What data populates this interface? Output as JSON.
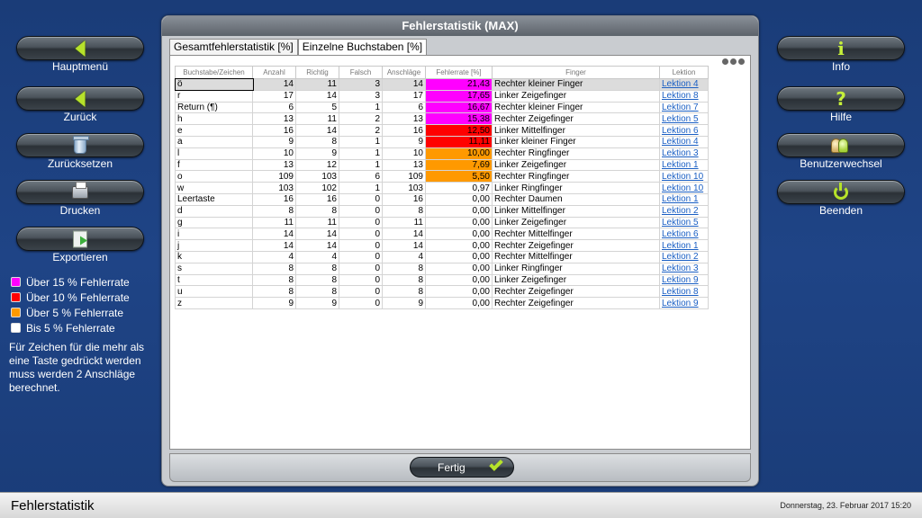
{
  "left_menu": [
    {
      "label": "Hauptmenü",
      "icon": "arrow-left-icon"
    },
    {
      "label": "Zurück",
      "icon": "arrow-left-icon"
    },
    {
      "label": "Zurücksetzen",
      "icon": "trash-icon"
    },
    {
      "label": "Drucken",
      "icon": "printer-icon"
    },
    {
      "label": "Exportieren",
      "icon": "export-icon"
    }
  ],
  "right_menu": [
    {
      "label": "Info",
      "icon": "info-icon"
    },
    {
      "label": "Hilfe",
      "icon": "help-icon"
    },
    {
      "label": "Benutzerwechsel",
      "icon": "users-icon"
    },
    {
      "label": "Beenden",
      "icon": "power-icon"
    }
  ],
  "legend": [
    {
      "label": "Über 15 % Fehlerrate",
      "color": "#ff00ff"
    },
    {
      "label": "Über 10 % Fehlerrate",
      "color": "#ff0000"
    },
    {
      "label": "Über 5 % Fehlerrate",
      "color": "#ff9900"
    },
    {
      "label": "Bis 5 % Fehlerrate",
      "color": "#ffffff"
    }
  ],
  "note": "Für Zeichen für die mehr als eine Taste gedrückt werden muss werden 2 Anschläge berechnet.",
  "window": {
    "title": "Fehlerstatistik (MAX)",
    "tabs": [
      "Gesamtfehlerstatistik [%]",
      "Einzelne Buchstaben [%]"
    ],
    "active_tab": 1,
    "ok_label": "Fertig"
  },
  "table": {
    "headers": [
      "Buchstabe/Zeichen",
      "Anzahl",
      "Richtig",
      "Falsch",
      "Anschläge",
      "Fehlerrate [%]",
      "Finger",
      "Lektion"
    ],
    "rows": [
      [
        "ö",
        "14",
        "11",
        "3",
        "14",
        "21,43",
        "Rechter kleiner Finger",
        "Lektion 4"
      ],
      [
        "r",
        "17",
        "14",
        "3",
        "17",
        "17,65",
        "Linker Zeigefinger",
        "Lektion 8"
      ],
      [
        "Return (¶)",
        "6",
        "5",
        "1",
        "6",
        "16,67",
        "Rechter kleiner Finger",
        "Lektion 7"
      ],
      [
        "h",
        "13",
        "11",
        "2",
        "13",
        "15,38",
        "Rechter Zeigefinger",
        "Lektion 5"
      ],
      [
        "e",
        "16",
        "14",
        "2",
        "16",
        "12,50",
        "Linker Mittelfinger",
        "Lektion 6"
      ],
      [
        "a",
        "9",
        "8",
        "1",
        "9",
        "11,11",
        "Linker kleiner Finger",
        "Lektion 4"
      ],
      [
        "l",
        "10",
        "9",
        "1",
        "10",
        "10,00",
        "Rechter Ringfinger",
        "Lektion 3"
      ],
      [
        "f",
        "13",
        "12",
        "1",
        "13",
        "7,69",
        "Linker Zeigefinger",
        "Lektion 1"
      ],
      [
        "o",
        "109",
        "103",
        "6",
        "109",
        "5,50",
        "Rechter Ringfinger",
        "Lektion 10"
      ],
      [
        "w",
        "103",
        "102",
        "1",
        "103",
        "0,97",
        "Linker Ringfinger",
        "Lektion 10"
      ],
      [
        "Leertaste",
        "16",
        "16",
        "0",
        "16",
        "0,00",
        "Rechter Daumen",
        "Lektion 1"
      ],
      [
        "d",
        "8",
        "8",
        "0",
        "8",
        "0,00",
        "Linker Mittelfinger",
        "Lektion 2"
      ],
      [
        "g",
        "11",
        "11",
        "0",
        "11",
        "0,00",
        "Linker Zeigefinger",
        "Lektion 5"
      ],
      [
        "i",
        "14",
        "14",
        "0",
        "14",
        "0,00",
        "Rechter Mittelfinger",
        "Lektion 6"
      ],
      [
        "j",
        "14",
        "14",
        "0",
        "14",
        "0,00",
        "Rechter Zeigefinger",
        "Lektion 1"
      ],
      [
        "k",
        "4",
        "4",
        "0",
        "4",
        "0,00",
        "Rechter Mittelfinger",
        "Lektion 2"
      ],
      [
        "s",
        "8",
        "8",
        "0",
        "8",
        "0,00",
        "Linker Ringfinger",
        "Lektion 3"
      ],
      [
        "t",
        "8",
        "8",
        "0",
        "8",
        "0,00",
        "Linker Zeigefinger",
        "Lektion 9"
      ],
      [
        "u",
        "8",
        "8",
        "0",
        "8",
        "0,00",
        "Rechter Zeigefinger",
        "Lektion 8"
      ],
      [
        "z",
        "9",
        "9",
        "0",
        "9",
        "0,00",
        "Rechter Zeigefinger",
        "Lektion 9"
      ]
    ]
  },
  "statusbar": {
    "title": "Fehlerstatistik",
    "date": "Donnerstag, 23. Februar 2017 15:20"
  }
}
